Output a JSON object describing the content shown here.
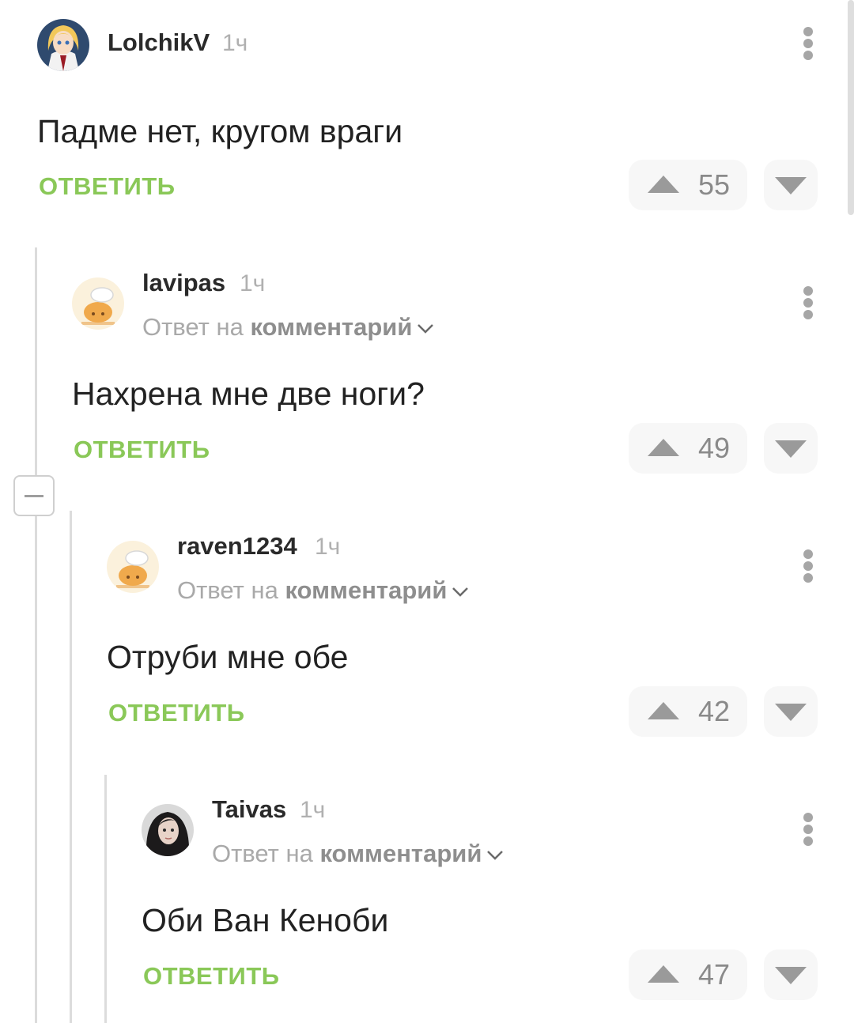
{
  "colors": {
    "accent_green": "#8ac858",
    "vote_bg": "#f7f7f7",
    "thread_line": "#dcdcdc"
  },
  "reply_prefix": "Ответ на",
  "reply_target": "комментарий",
  "reply_button_label": "ОТВЕТИТЬ",
  "comments": [
    {
      "author": "LolchikV",
      "time": "1ч",
      "text": "Падме нет, кругом враги",
      "rating": "55",
      "avatar": "anime-girl-avatar"
    },
    {
      "author": "lavipas",
      "time": "1ч",
      "text": "Нахрена мне две ноги?",
      "rating": "49",
      "avatar": "default-bun-avatar"
    },
    {
      "author": "raven1234",
      "time": "1ч",
      "text": "Отруби мне обе",
      "rating": "42",
      "avatar": "default-bun-avatar"
    },
    {
      "author": "Taivas",
      "time": "1ч",
      "text": "Оби Ван Кеноби",
      "rating": "47",
      "avatar": "dark-hair-girl-avatar"
    }
  ]
}
